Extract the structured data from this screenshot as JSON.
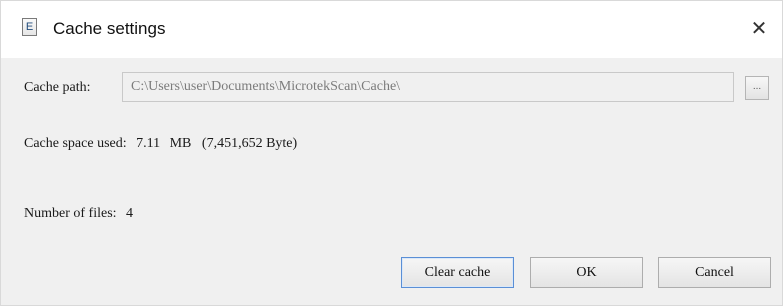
{
  "window": {
    "title": "Cache settings",
    "app_icon_letter": "E",
    "close_glyph": "✕"
  },
  "cache": {
    "path_label": "Cache path:",
    "path_value": "C:\\Users\\user\\Documents\\MicrotekScan\\Cache\\",
    "browse_label": "...",
    "space_label": "Cache space used:",
    "space_value": "7.11",
    "space_unit": "MB",
    "space_bytes": "(7,451,652 Byte)",
    "files_label": "Number of files:",
    "files_value": "4"
  },
  "buttons": {
    "clear_cache": "Clear cache",
    "ok": "OK",
    "cancel": "Cancel"
  },
  "colors": {
    "content_background": "#f0f0f0",
    "default_button_border": "#5a8fd6"
  },
  "icons": {
    "app_icon": "app-icon",
    "close": "close-icon"
  }
}
